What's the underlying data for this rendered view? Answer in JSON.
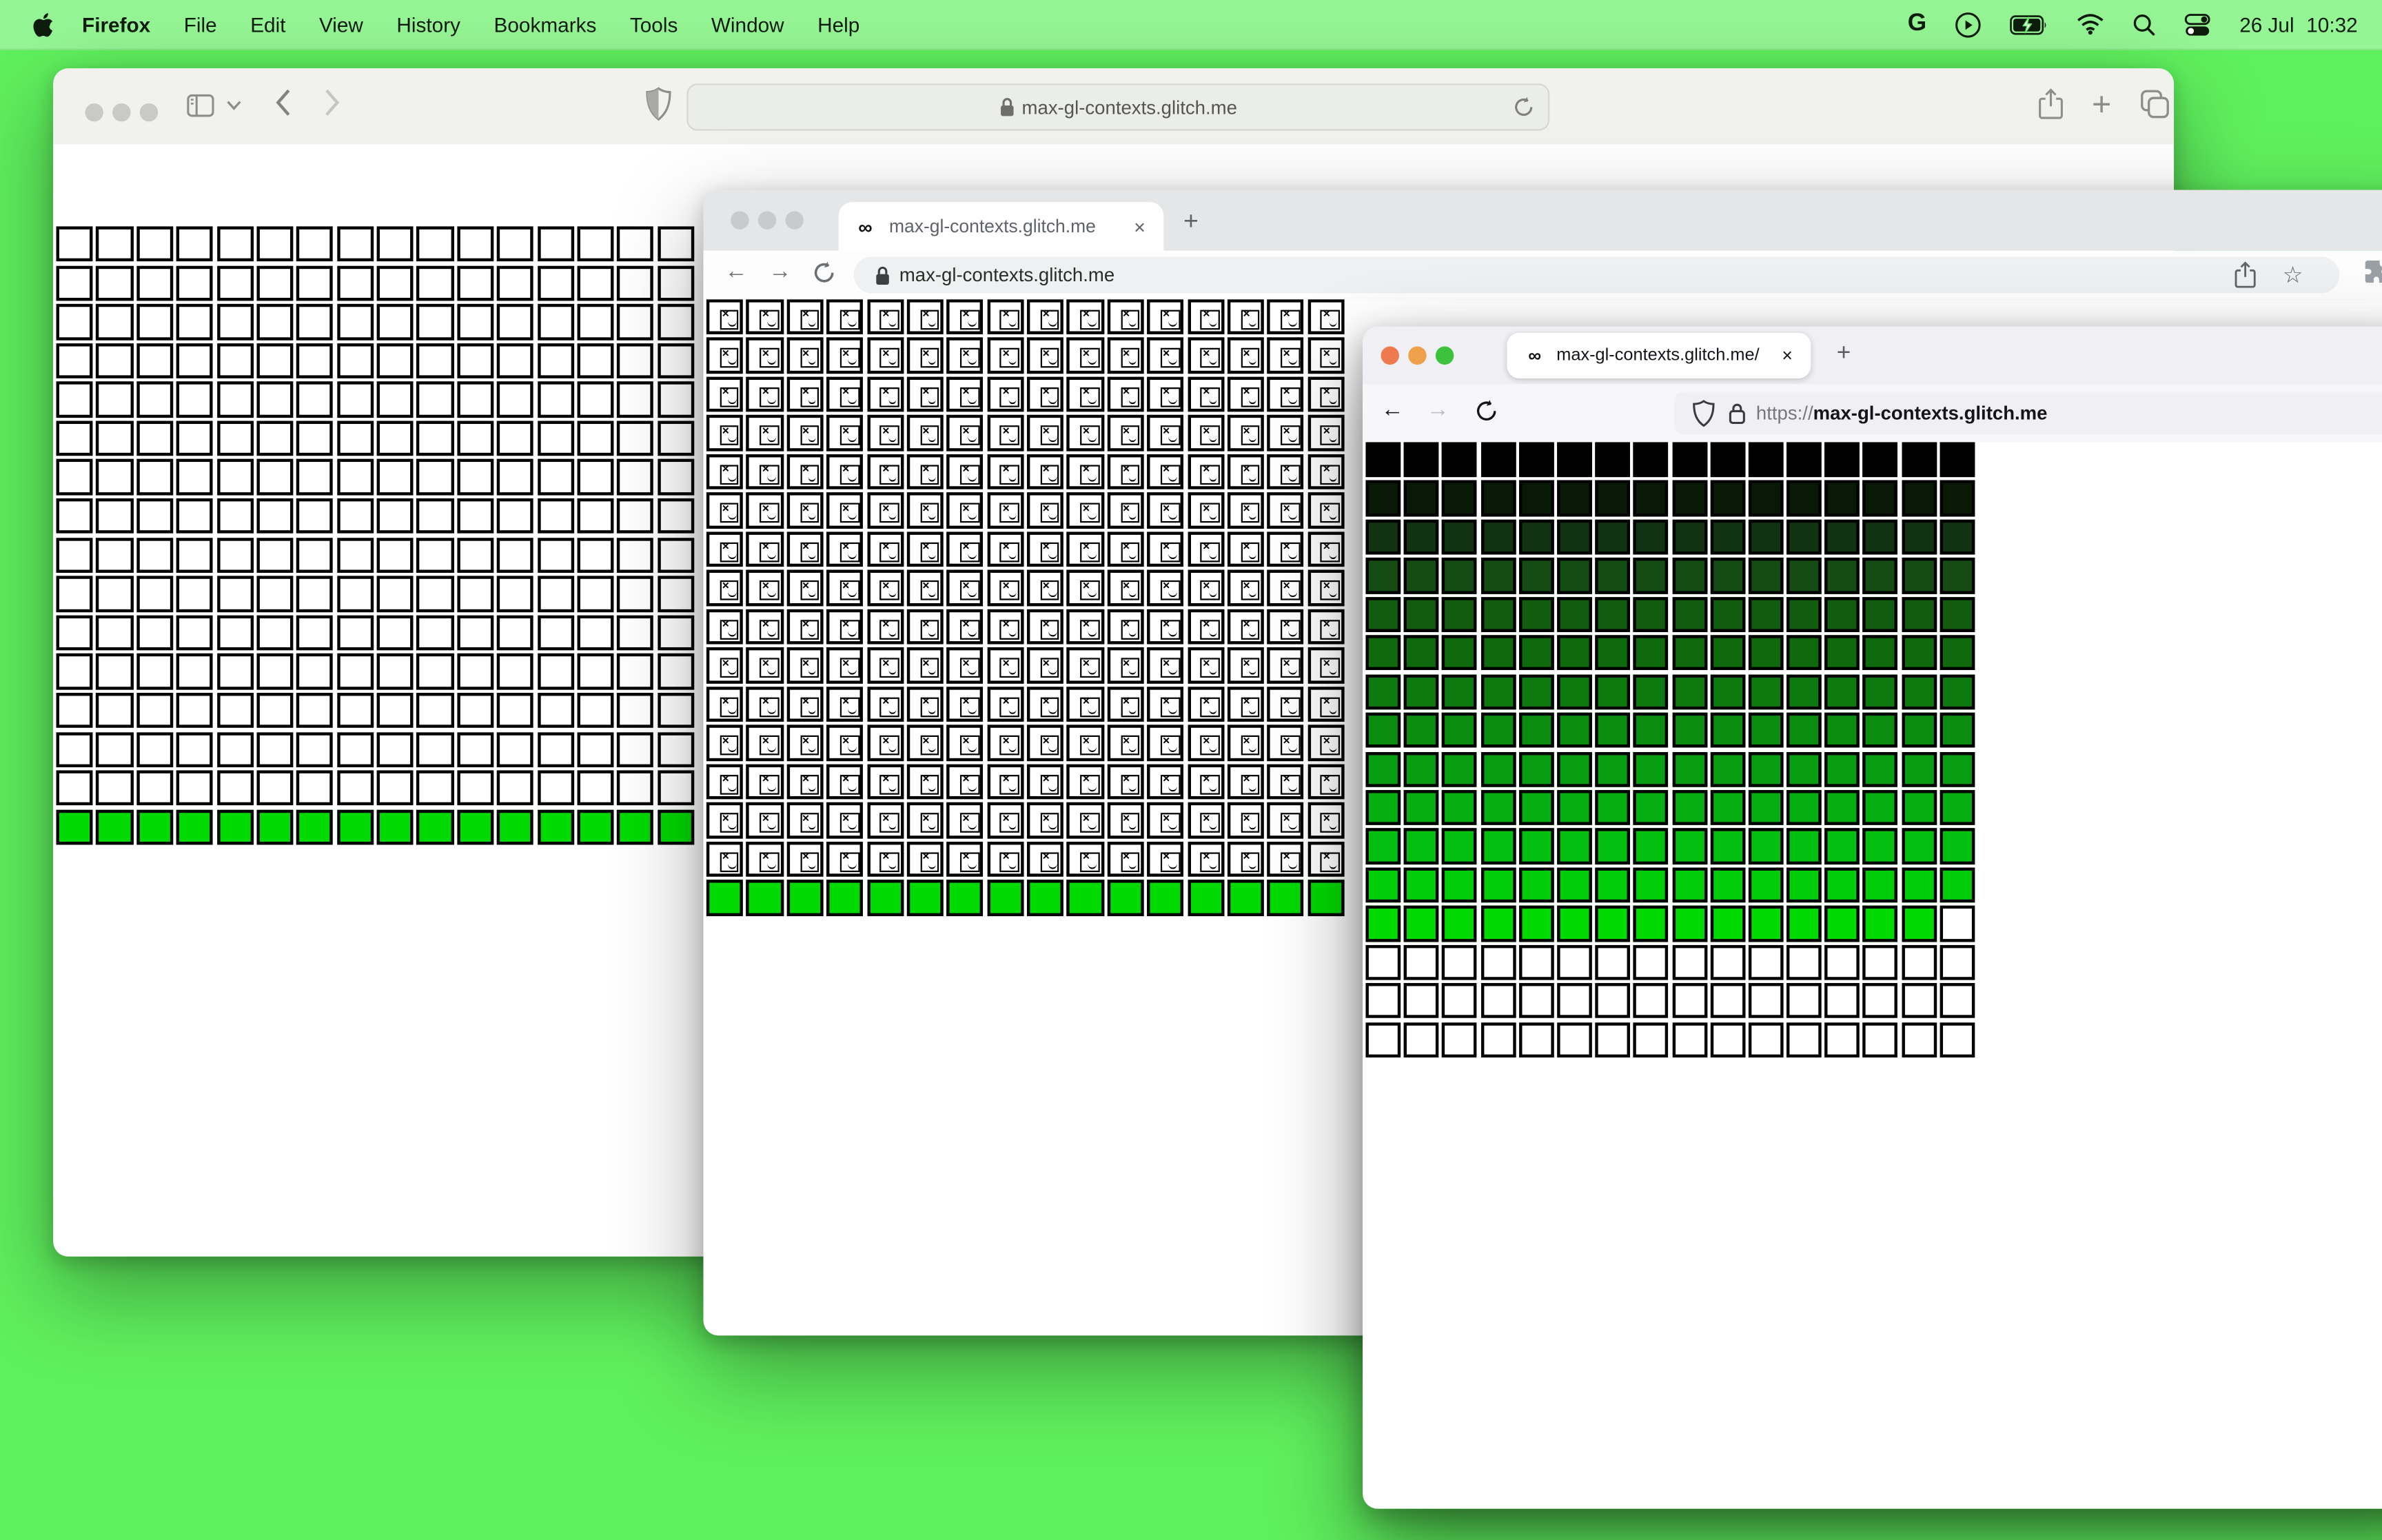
{
  "menu_bar": {
    "app_name": "Firefox",
    "menus": [
      "File",
      "Edit",
      "View",
      "History",
      "Bookmarks",
      "Tools",
      "Window",
      "Help"
    ],
    "clock_date": "26 Jul",
    "clock_time": "10:32"
  },
  "colors": {
    "desktop": "#5ff05d",
    "active_green": "#00da00",
    "menubar_tint": "rgba(255,255,255,0.34)"
  },
  "glyphs": {
    "favicon_infinity": "∞",
    "tab_close": "×",
    "new_tab_plus": "+",
    "back_arrow": "←",
    "forward_arrow": "→"
  },
  "safari_window": {
    "url": "max-gl-contexts.glitch.me",
    "grid": {
      "cols": 16,
      "rows": [
        "empty",
        "empty",
        "empty",
        "empty",
        "empty",
        "empty",
        "empty",
        "empty",
        "empty",
        "empty",
        "empty",
        "empty",
        "empty",
        "empty",
        "empty",
        "active"
      ]
    }
  },
  "chrome_window": {
    "tab_title": "max-gl-contexts.glitch.me",
    "url": "max-gl-contexts.glitch.me",
    "grid": {
      "cols": 16,
      "rows": [
        "broken",
        "broken",
        "broken",
        "broken",
        "broken",
        "broken",
        "broken",
        "broken",
        "broken",
        "broken",
        "broken",
        "broken",
        "broken",
        "broken",
        "broken",
        "active"
      ]
    }
  },
  "firefox_window": {
    "tab_title": "max-gl-contexts.glitch.me/",
    "url_scheme": "https://",
    "url_host": "max-gl-contexts.glitch.me",
    "grid": {
      "cols": 16,
      "rows": [
        "#000000",
        "#081a05",
        "#113311",
        "#154c13",
        "#125c10",
        "#0f6a0e",
        "#0c7a0e",
        "#0a8c10",
        "#079e11",
        "#05af12",
        "#03bf10",
        "#01cd09",
        "#00da00",
        "#ffffff",
        "#ffffff",
        "#ffffff"
      ],
      "white_cells": [
        [
          12,
          15
        ]
      ]
    }
  }
}
